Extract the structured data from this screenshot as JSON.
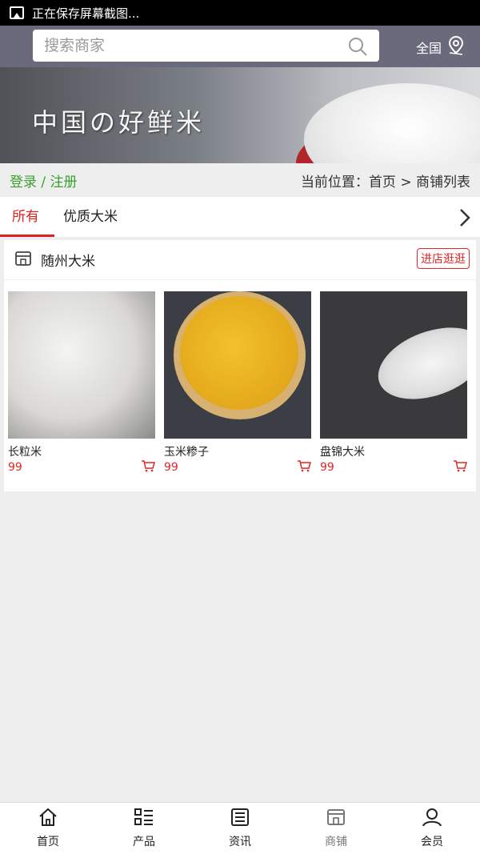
{
  "status_bar": {
    "text": "正在保存屏幕截图..."
  },
  "header": {
    "search_placeholder": "搜索商家",
    "region_label": "全国"
  },
  "banner": {
    "title": "中国の好鲜米"
  },
  "location_bar": {
    "auth_text": "登录 / 注册",
    "breadcrumb": "当前位置：首页 > 商铺列表"
  },
  "tabs": [
    {
      "label": "所有",
      "active": true
    },
    {
      "label": "优质大米",
      "active": false
    }
  ],
  "shop": {
    "name": "随州大米",
    "enter_label": "进店逛逛",
    "products": [
      {
        "name": "长粒米",
        "price": "99"
      },
      {
        "name": "玉米糁子",
        "price": "99"
      },
      {
        "name": "盘锦大米",
        "price": "99"
      }
    ]
  },
  "bottom_nav": [
    {
      "label": "首页",
      "icon": "home-icon"
    },
    {
      "label": "产品",
      "icon": "list-icon"
    },
    {
      "label": "资讯",
      "icon": "news-icon"
    },
    {
      "label": "商铺",
      "icon": "store-icon",
      "active": true
    },
    {
      "label": "会员",
      "icon": "user-icon"
    }
  ],
  "colors": {
    "accent_red": "#e21f1f",
    "auth_green": "#3aa030",
    "header_bg": "#6b6a7d"
  }
}
